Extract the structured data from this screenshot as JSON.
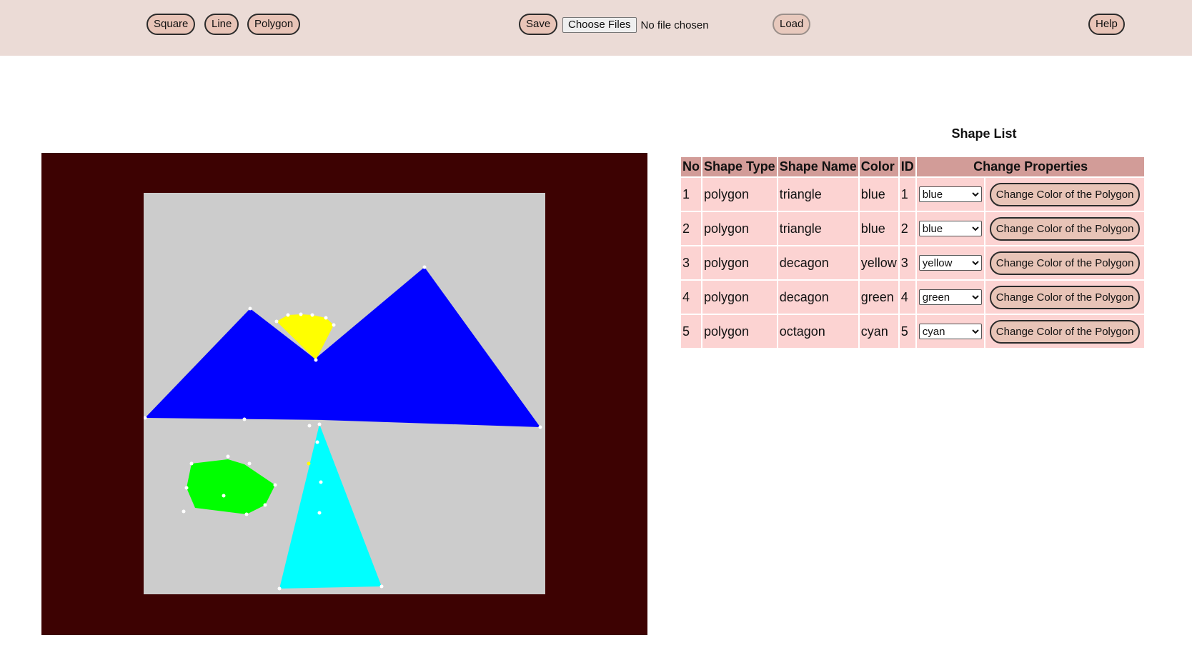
{
  "toolbar": {
    "square_label": "Square",
    "line_label": "Line",
    "polygon_label": "Polygon",
    "save_label": "Save",
    "choose_files_label": "Choose Files",
    "file_status": "No file chosen",
    "load_label": "Load",
    "help_label": "Help"
  },
  "colors": {
    "toolbar_bg": "#ebdbd6",
    "canvas_frame": "#3d0202",
    "canvas_bg": "#cccccc",
    "table_header_bg": "#d29c98",
    "table_cell_bg": "#fcd3d2",
    "button_bg": "#e8c4b7"
  },
  "shape_list": {
    "title": "Shape List",
    "headers": {
      "no": "No",
      "shape_type": "Shape Type",
      "shape_name": "Shape Name",
      "color": "Color",
      "id": "ID",
      "change_properties": "Change Properties"
    },
    "color_options": [
      "blue",
      "yellow",
      "green",
      "cyan"
    ],
    "rows": [
      {
        "no": "1",
        "type": "polygon",
        "name": "triangle",
        "color": "blue",
        "id": "1",
        "selected": "blue",
        "button": "Change Color of the Polygon"
      },
      {
        "no": "2",
        "type": "polygon",
        "name": "triangle",
        "color": "blue",
        "id": "2",
        "selected": "blue",
        "button": "Change Color of the Polygon"
      },
      {
        "no": "3",
        "type": "polygon",
        "name": "decagon",
        "color": "yellow",
        "id": "3",
        "selected": "yellow",
        "button": "Change Color of the Polygon"
      },
      {
        "no": "4",
        "type": "polygon",
        "name": "decagon",
        "color": "green",
        "id": "4",
        "selected": "green",
        "button": "Change Color of the Polygon"
      },
      {
        "no": "5",
        "type": "polygon",
        "name": "octagon",
        "color": "cyan",
        "id": "5",
        "selected": "cyan",
        "button": "Change Color of the Polygon"
      }
    ]
  }
}
